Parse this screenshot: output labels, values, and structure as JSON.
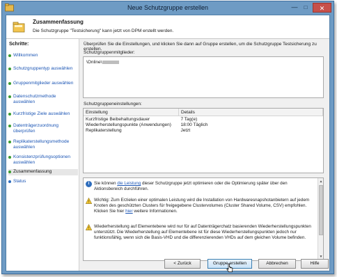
{
  "window": {
    "title": "Neue Schutzgruppe erstellen",
    "minimize_glyph": "—",
    "maximize_glyph": "□",
    "close_glyph": "✕"
  },
  "header": {
    "title": "Zusammenfassung",
    "subtitle": "Die Schutzgruppe \"Testsicherung\" kann jetzt von DPM erstellt werden.",
    "icon": "folder-icon"
  },
  "sidebar": {
    "heading": "Schritte:",
    "items": [
      {
        "label": "Willkommen"
      },
      {
        "label": "Schutzgruppentyp auswählen"
      },
      {
        "label": "Gruppenmitglieder auswählen"
      },
      {
        "label": "Datenschutzmethode auswählen"
      },
      {
        "label": "Kurzfristige Ziele auswählen"
      },
      {
        "label": "Datenträgerzuordnung überprüfen"
      },
      {
        "label": "Replikaterstellungsmethode auswählen"
      },
      {
        "label": "Konsistenzprüfungsoptionen auswählen"
      },
      {
        "label": "Zusammenfassung"
      },
      {
        "label": "Status"
      }
    ]
  },
  "main": {
    "intro": "Überprüfen Sie die Einstellungen, und klicken Sie dann auf Gruppe erstellen, um die Schutzgruppe Testsicherung zu erstellen.",
    "members_label": "Schutzgruppenmitglieder:",
    "member_value": "\\Online\\",
    "settings_label": "Schutzgruppeneinstellungen:",
    "settings_headers": [
      "Einstellung",
      "Details"
    ],
    "settings_rows": [
      [
        "Kurzfristige Beibehaltungsdauer",
        "7 Tag(e)"
      ],
      [
        "Wiederherstellungspunkte (Anwendungen)",
        "18:00 Täglich"
      ],
      [
        "Replikaterstellung",
        "Jetzt"
      ]
    ],
    "notes": {
      "n1_before": "Sie können ",
      "n1_link": "die Leistung",
      "n1_after": " dieser Schutzgruppe jetzt optimieren oder die Optimierung später über den Aktionsbereich durchführen.",
      "n2_before": "Wichtig: Zum Erzielen einer optimalen Leistung wird die Installation von Hardwaresnapshotanbietern auf jedem Knoten des geschützten Clusters für freigegebene Clustervolumes (Cluster Shared Volume, CSV) empfohlen. Klicken Sie hier ",
      "n2_link": "hier",
      "n2_after": " weitere Informationen.",
      "n3": "Wiederherstellung auf Elementebene wird nur für auf Datenträgerchatz basierenden Wiederherstellungspunkten unterstützt. Die Wiederherstellung auf Elementebene ist für diese Wiederherstellungspunkten jedoch nur funktionsfähig, wenn sich die Basis-VHD und die differenzierenden VHDs auf dem gleichen Volume befinden."
    }
  },
  "buttons": {
    "back": "< Zurück",
    "create": "Gruppe erstellen",
    "cancel": "Abbrechen",
    "help": "Hilfe"
  },
  "colors": {
    "title_bar": "#6e9bc4",
    "close_button": "#c7504a",
    "link": "#1c56b5",
    "step_dot": "#3a9c2e"
  }
}
